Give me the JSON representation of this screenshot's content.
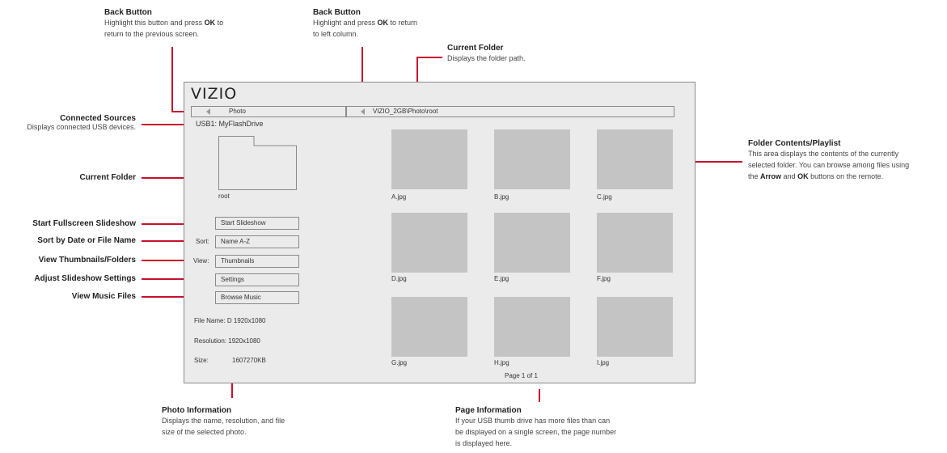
{
  "callouts": {
    "back1": {
      "title": "Back Button",
      "desc_pre": "Highlight this button and press ",
      "desc_bold": "OK",
      "desc_post": " to",
      "desc_line2": "return to the previous screen."
    },
    "back2": {
      "title": "Back Button",
      "desc_pre": "Highlight and press ",
      "desc_bold": "OK",
      "desc_post": " to return",
      "desc_line2": "to left column."
    },
    "current_folder_top": {
      "title": "Current Folder",
      "desc": "Displays the folder path."
    },
    "folder_contents": {
      "title": "Folder Contents/Playlist",
      "line1": "This area displays the contents of the currently",
      "line2": "selected folder. You can browse among files using",
      "line3_pre": "the ",
      "line3_b1": "Arrow",
      "line3_mid": " and ",
      "line3_b2": "OK",
      "line3_post": " buttons on the remote."
    },
    "connected_sources": {
      "title": "Connected Sources",
      "desc": "Displays connected USB devices."
    },
    "current_folder_left": "Current Folder",
    "start_slideshow": "Start Fullscreen Slideshow",
    "sort": "Sort by Date or File Name",
    "view": "View Thumbnails/Folders",
    "settings": "Adjust Slideshow Settings",
    "music": "View Music Files",
    "photo_info": {
      "title": "Photo Information",
      "line1": "Displays the name, resolution, and file",
      "line2": "size of the selected photo."
    },
    "page_info": {
      "title": "Page Information",
      "line1": "If your USB thumb drive has more files than can",
      "line2": "be displayed on a single screen, the page number",
      "line3": "is displayed here."
    }
  },
  "screen": {
    "logo": "VIZIO",
    "left_bar_label": "Photo",
    "path": "VIZIO_2GB\\Photo\\root",
    "source": "USB1: MyFlashDrive",
    "folder_name": "root",
    "start_slideshow_btn": "Start Slideshow",
    "sort_label": "Sort:",
    "sort_value": "Name A-Z",
    "view_label": "View:",
    "view_value": "Thumbnails",
    "settings_btn": "Settings",
    "music_btn": "Browse Music",
    "file_name": "File Name: D 1920x1080",
    "resolution": "Resolution: 1920x1080",
    "size_label": "Size:",
    "size_value": "1607270KB",
    "thumbs": [
      "A.jpg",
      "B.jpg",
      "C.jpg",
      "D.jpg",
      "E.jpg",
      "F.jpg",
      "G.jpg",
      "H.jpg",
      "I.jpg"
    ],
    "page": "Page 1 of 1"
  }
}
